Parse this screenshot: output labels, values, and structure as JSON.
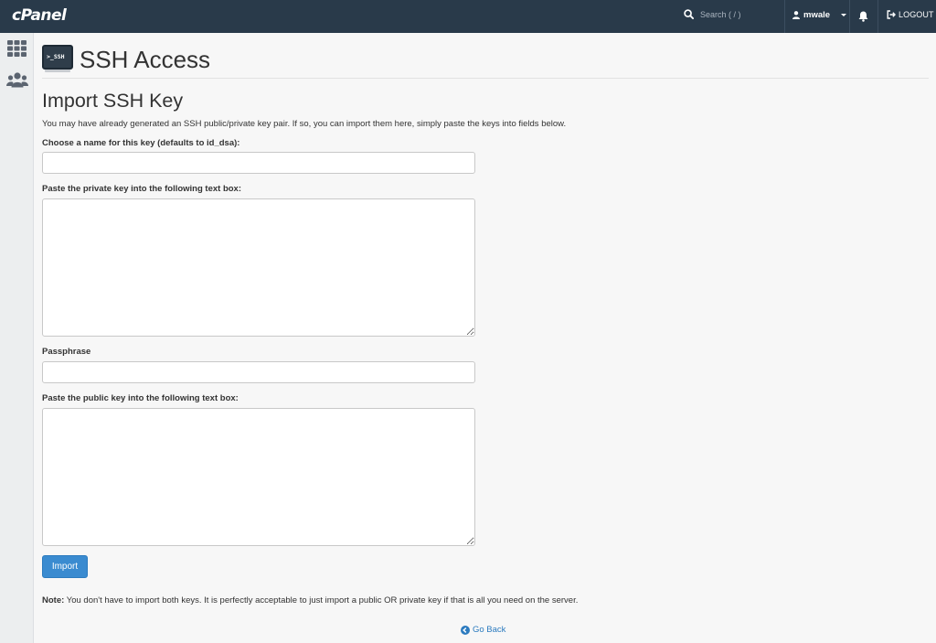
{
  "topbar": {
    "logo": "cPanel",
    "search_placeholder": "Search ( / )",
    "username": "mwale",
    "logout_label": "LOGOUT"
  },
  "sidebar": {
    "items": [
      {
        "icon": "apps-grid-icon"
      },
      {
        "icon": "users-icon"
      }
    ]
  },
  "header": {
    "icon_text": ">_SSH",
    "title": "SSH Access"
  },
  "form": {
    "title": "Import SSH Key",
    "intro": "You may have already generated an SSH public/private key pair. If so, you can import them here, simply paste the keys into fields below.",
    "name_label": "Choose a name for this key (defaults to id_dsa):",
    "name_value": "",
    "private_key_label": "Paste the private key into the following text box:",
    "private_key_value": "",
    "passphrase_label": "Passphrase",
    "passphrase_value": "",
    "public_key_label": "Paste the public key into the following text box:",
    "public_key_value": "",
    "import_button": "Import",
    "note_prefix": "Note:",
    "note_text": " You don't have to import both keys. It is perfectly acceptable to just import a public OR private key if that is all you need on the server.",
    "go_back": "Go Back"
  },
  "colors": {
    "topbar_bg": "#293a4a",
    "accent": "#3a8bd0",
    "link": "#2c7bbf"
  }
}
